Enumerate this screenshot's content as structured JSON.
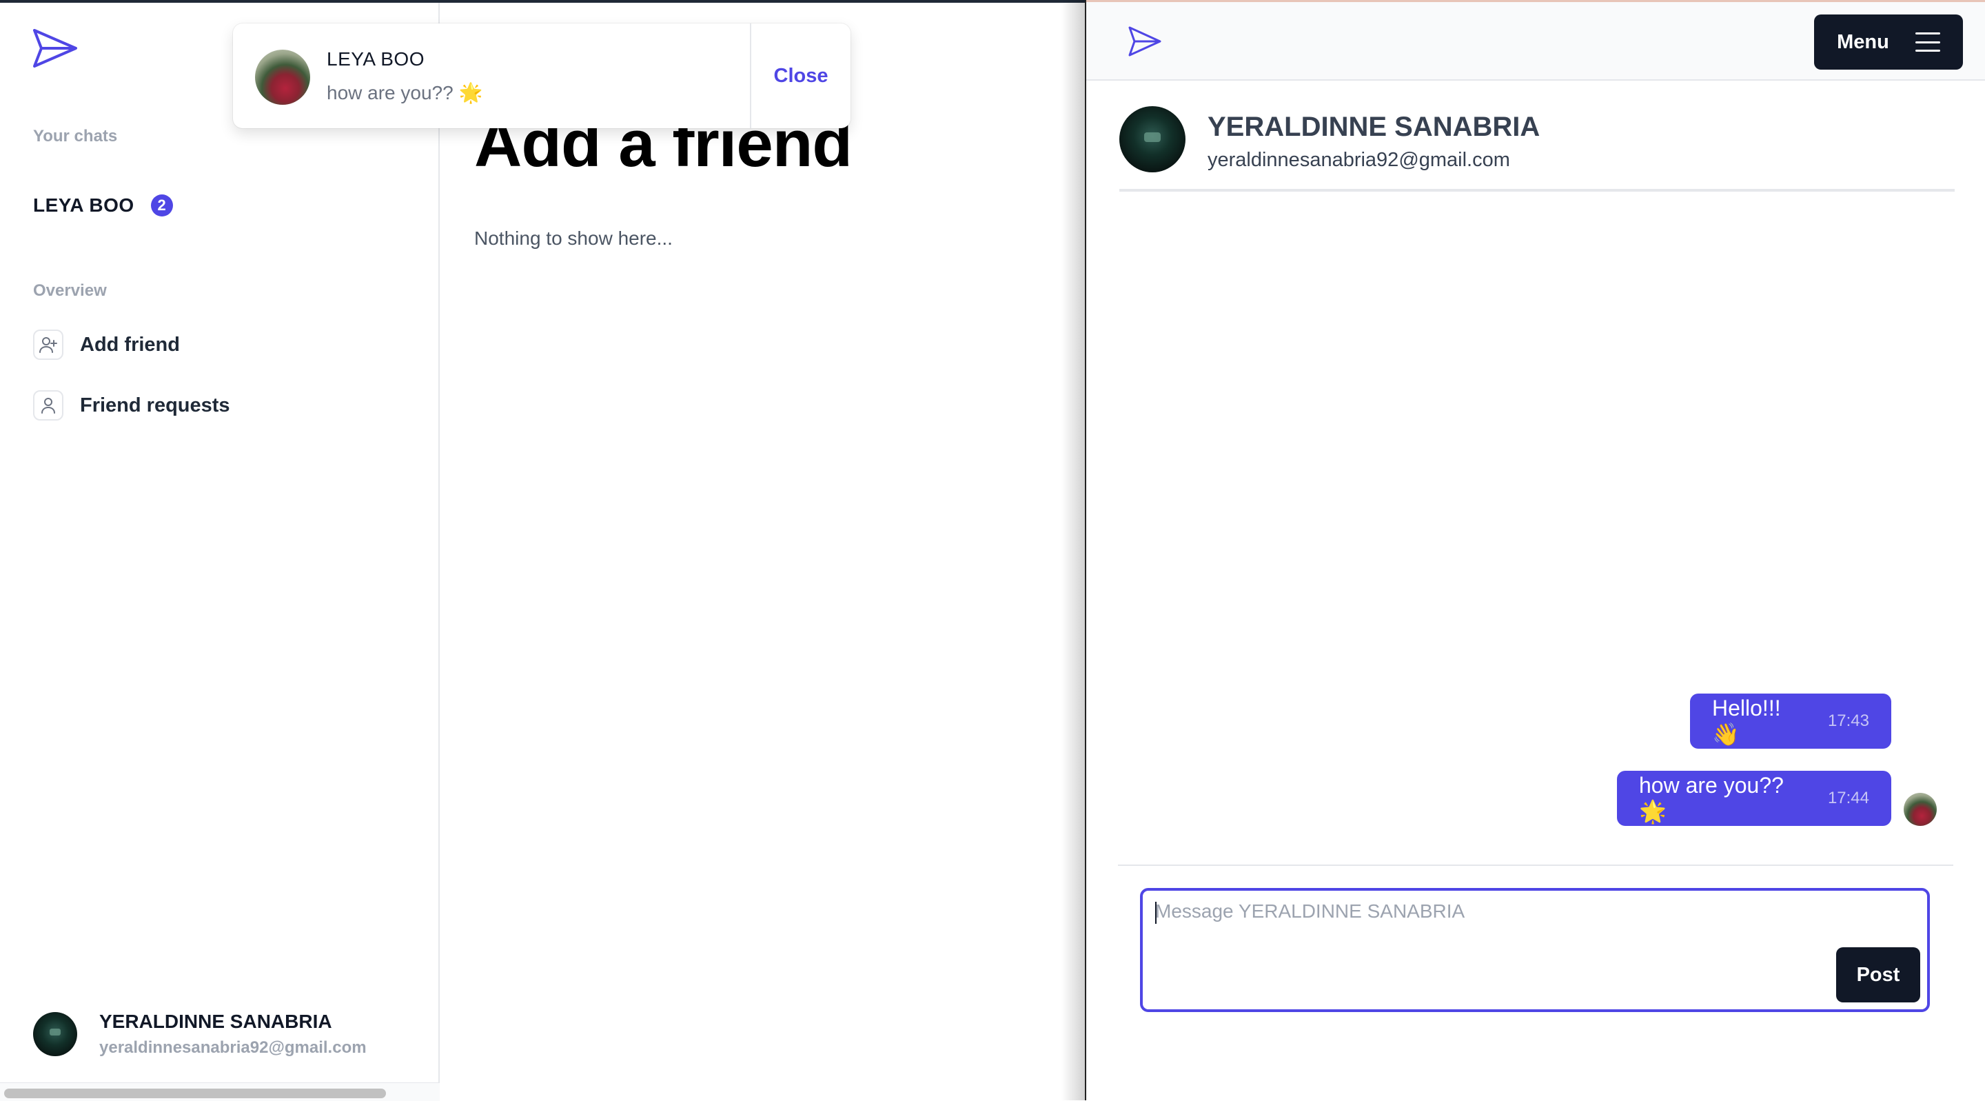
{
  "sidebar": {
    "your_chats_label": "Your chats",
    "chats": [
      {
        "name": "LEYA BOO",
        "unread": "2"
      }
    ],
    "overview_label": "Overview",
    "overview_items": [
      {
        "label": "Add friend",
        "icon": "user-plus-icon"
      },
      {
        "label": "Friend requests",
        "icon": "user-icon"
      }
    ],
    "profile": {
      "name": "YERALDINNE SANABRIA",
      "email": "yeraldinnesanabria92@gmail.com"
    }
  },
  "main": {
    "title": "Add a friend",
    "empty_text": "Nothing to show here..."
  },
  "toast": {
    "sender": "LEYA BOO",
    "message": "how are you?? 🌟",
    "close_label": "Close"
  },
  "chat_window": {
    "menu_label": "Menu",
    "partner": {
      "name": "YERALDINNE SANABRIA",
      "email": "yeraldinnesanabria92@gmail.com"
    },
    "messages": [
      {
        "text": "Hello!!! 👋",
        "time": "17:43"
      },
      {
        "text": "how are you?? 🌟",
        "time": "17:44"
      }
    ],
    "composer": {
      "placeholder": "Message YERALDINNE SANABRIA",
      "post_label": "Post"
    }
  },
  "colors": {
    "accent": "#4f46e5",
    "dark": "#111827",
    "muted": "#9ca3af"
  }
}
